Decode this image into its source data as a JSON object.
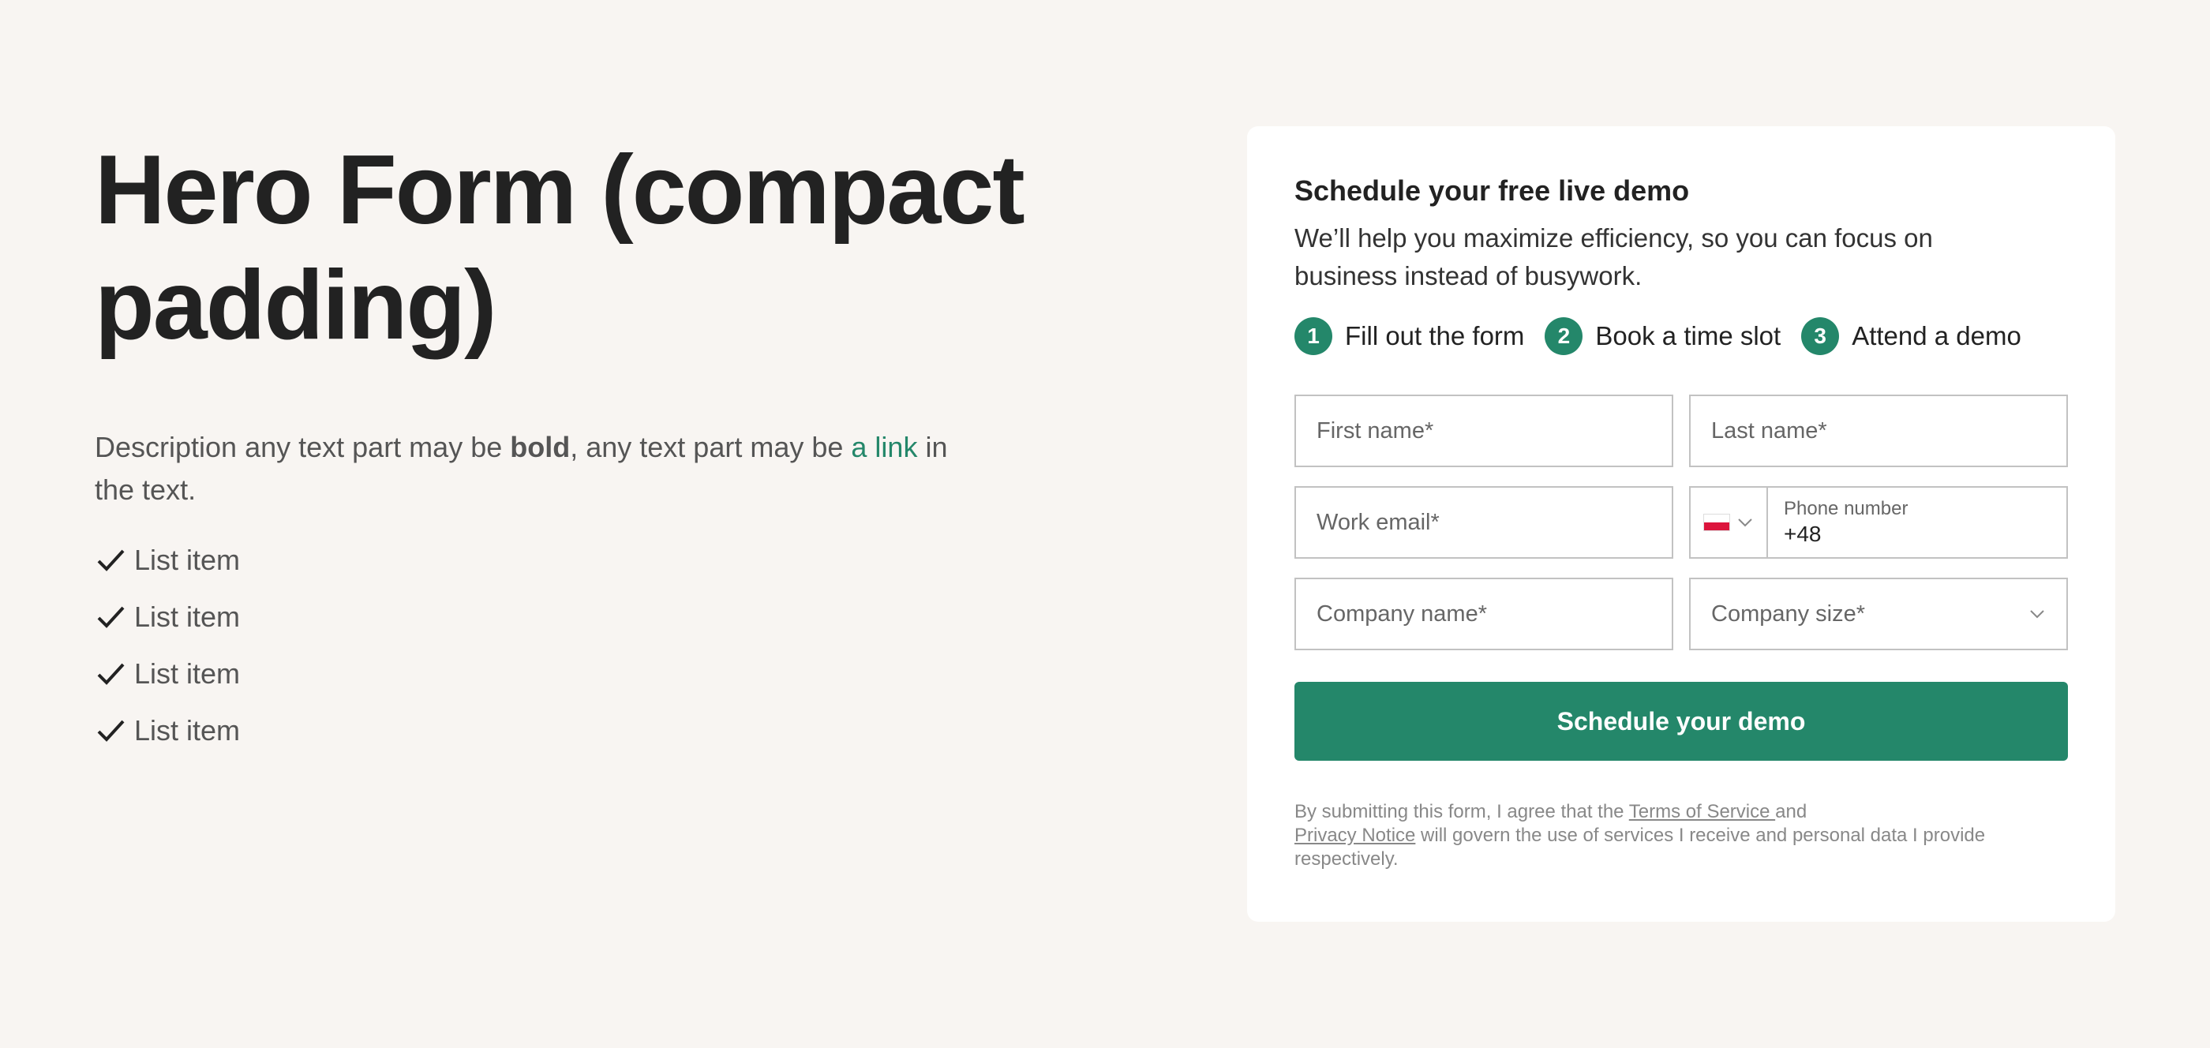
{
  "hero": {
    "title": "Hero Form (compact padding)",
    "desc_pre": "Description any text part may be ",
    "desc_bold": "bold",
    "desc_mid": ", any text part may be ",
    "desc_link": "a link",
    "desc_post": " in the text.",
    "list": [
      "List item",
      "List item",
      "List item",
      "List item"
    ],
    "list_icon": "check-icon"
  },
  "form": {
    "title": "Schedule your free live demo",
    "subtitle": "We’ll help you maximize efficiency, so you can focus on business instead of busywork.",
    "steps": [
      {
        "num": "1",
        "label": "Fill out the form"
      },
      {
        "num": "2",
        "label": "Book a time slot"
      },
      {
        "num": "3",
        "label": "Attend a demo"
      }
    ],
    "first_name_placeholder": "First name*",
    "last_name_placeholder": "Last name*",
    "email_placeholder": "Work email*",
    "phone_label": "Phone number",
    "phone_value": "+48",
    "country_flag": "poland-flag-icon",
    "company_name_placeholder": "Company name*",
    "company_size_placeholder": "Company size*",
    "submit_label": "Schedule your demo",
    "legal_pre": "By submitting this form, I agree that the ",
    "legal_terms": "Terms of Service ",
    "legal_and": "and",
    "legal_privacy": "Privacy Notice",
    "legal_post": " will govern the use of services I receive and personal data I provide respectively."
  },
  "colors": {
    "accent": "#24876a",
    "background": "#f8f5f2",
    "card": "#ffffff"
  }
}
